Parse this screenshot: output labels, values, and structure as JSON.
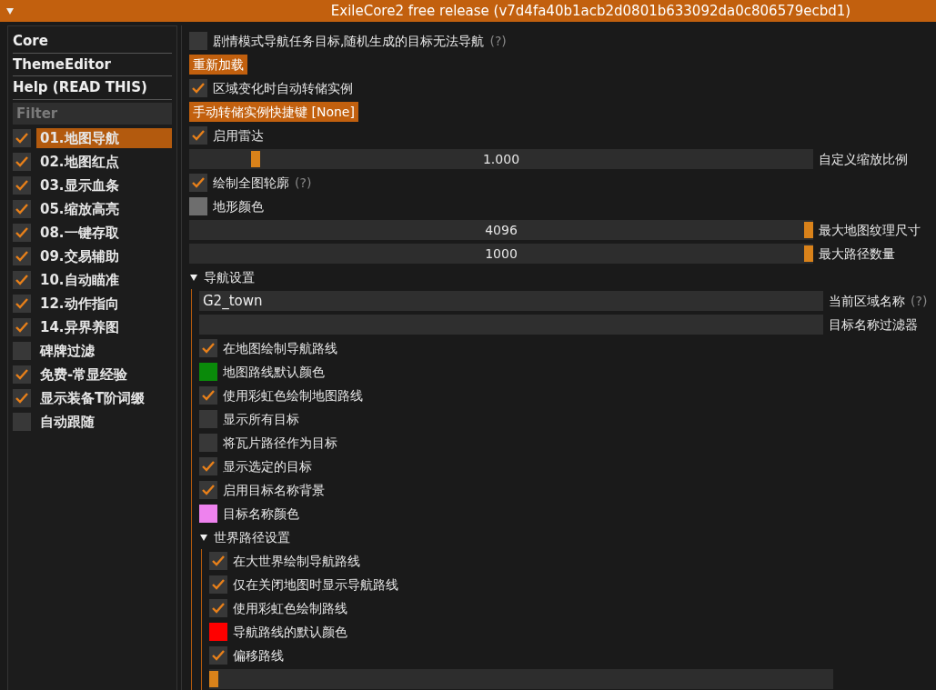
{
  "window": {
    "title": "ExileCore2 free release (v7d4fa40b1acb2d0801b633092da0c806579ecbd1)",
    "collapsed": false
  },
  "sidebar": {
    "headers": [
      "Core",
      "ThemeEditor",
      "Help (READ THIS)"
    ],
    "filter": {
      "placeholder": "Filter"
    },
    "plugins": [
      {
        "label": "01.地图导航",
        "checked": true,
        "selected": true
      },
      {
        "label": "02.地图红点",
        "checked": true,
        "selected": false
      },
      {
        "label": "03.显示血条",
        "checked": true,
        "selected": false
      },
      {
        "label": "05.缩放高亮",
        "checked": true,
        "selected": false
      },
      {
        "label": "08.一键存取",
        "checked": true,
        "selected": false
      },
      {
        "label": "09.交易辅助",
        "checked": true,
        "selected": false
      },
      {
        "label": "10.自动瞄准",
        "checked": true,
        "selected": false
      },
      {
        "label": "12.动作指向",
        "checked": true,
        "selected": false
      },
      {
        "label": "14.异界养图",
        "checked": true,
        "selected": false
      },
      {
        "label": "碑牌过滤",
        "checked": false,
        "selected": false
      },
      {
        "label": "免费-常显经验",
        "checked": true,
        "selected": false
      },
      {
        "label": "显示装备T阶词缀",
        "checked": true,
        "selected": false
      },
      {
        "label": "自动跟随",
        "checked": false,
        "selected": false
      }
    ]
  },
  "settings": [
    {
      "kind": "checkbox",
      "label": "剧情模式导航任务目标,随机生成的目标无法导航",
      "checked": false,
      "hint": "(?)"
    },
    {
      "kind": "button",
      "label": "重新加载"
    },
    {
      "kind": "checkbox",
      "label": "区域变化时自动转储实例",
      "checked": true
    },
    {
      "kind": "button",
      "label": "手动转储实例快捷键 [None]"
    },
    {
      "kind": "checkbox",
      "label": "启用雷达",
      "checked": true
    },
    {
      "kind": "slider",
      "reading": "1.000",
      "label": "自定义缩放比例",
      "level": 0.1
    },
    {
      "kind": "checkbox",
      "label": "绘制全图轮廓",
      "checked": true,
      "hint": "(?)"
    },
    {
      "kind": "color",
      "label": "地形颜色",
      "color": "#6e6e6e"
    },
    {
      "kind": "slider",
      "reading": "4096",
      "label": "最大地图纹理尺寸",
      "level": 1
    },
    {
      "kind": "slider",
      "reading": "1000",
      "label": "最大路径数量",
      "level": 1
    },
    {
      "kind": "node",
      "label": "导航设置",
      "expanded": true,
      "children": [
        {
          "kind": "input",
          "value": "G2_town",
          "label": "当前区域名称",
          "hint": "(?)"
        },
        {
          "kind": "input",
          "label": "目标名称过滤器"
        },
        {
          "kind": "checkbox",
          "label": "在地图绘制导航路线",
          "checked": true
        },
        {
          "kind": "color",
          "label": "地图路线默认颜色",
          "color": "#0a8a0a"
        },
        {
          "kind": "checkbox",
          "label": "使用彩虹色绘制地图路线",
          "checked": true
        },
        {
          "kind": "checkbox",
          "label": "显示所有目标",
          "checked": false
        },
        {
          "kind": "checkbox",
          "label": "将瓦片路径作为目标",
          "checked": false
        },
        {
          "kind": "checkbox",
          "label": "显示选定的目标",
          "checked": true
        },
        {
          "kind": "checkbox",
          "label": "启用目标名称背景",
          "checked": true
        },
        {
          "kind": "color",
          "label": "目标名称颜色",
          "color": "#ee82ee"
        },
        {
          "kind": "node",
          "label": "世界路径设置",
          "expanded": true,
          "children": [
            {
              "kind": "checkbox",
              "label": "在大世界绘制导航路线",
              "checked": true
            },
            {
              "kind": "checkbox",
              "label": "仅在关闭地图时显示导航路线",
              "checked": true
            },
            {
              "kind": "checkbox",
              "label": "使用彩虹色绘制路线",
              "checked": true
            },
            {
              "kind": "color",
              "label": "导航路线的默认颜色",
              "color": "#ff0000"
            },
            {
              "kind": "checkbox",
              "label": "偏移路线",
              "checked": true
            },
            {
              "kind": "slider",
              "level": 0
            }
          ]
        }
      ]
    }
  ]
}
